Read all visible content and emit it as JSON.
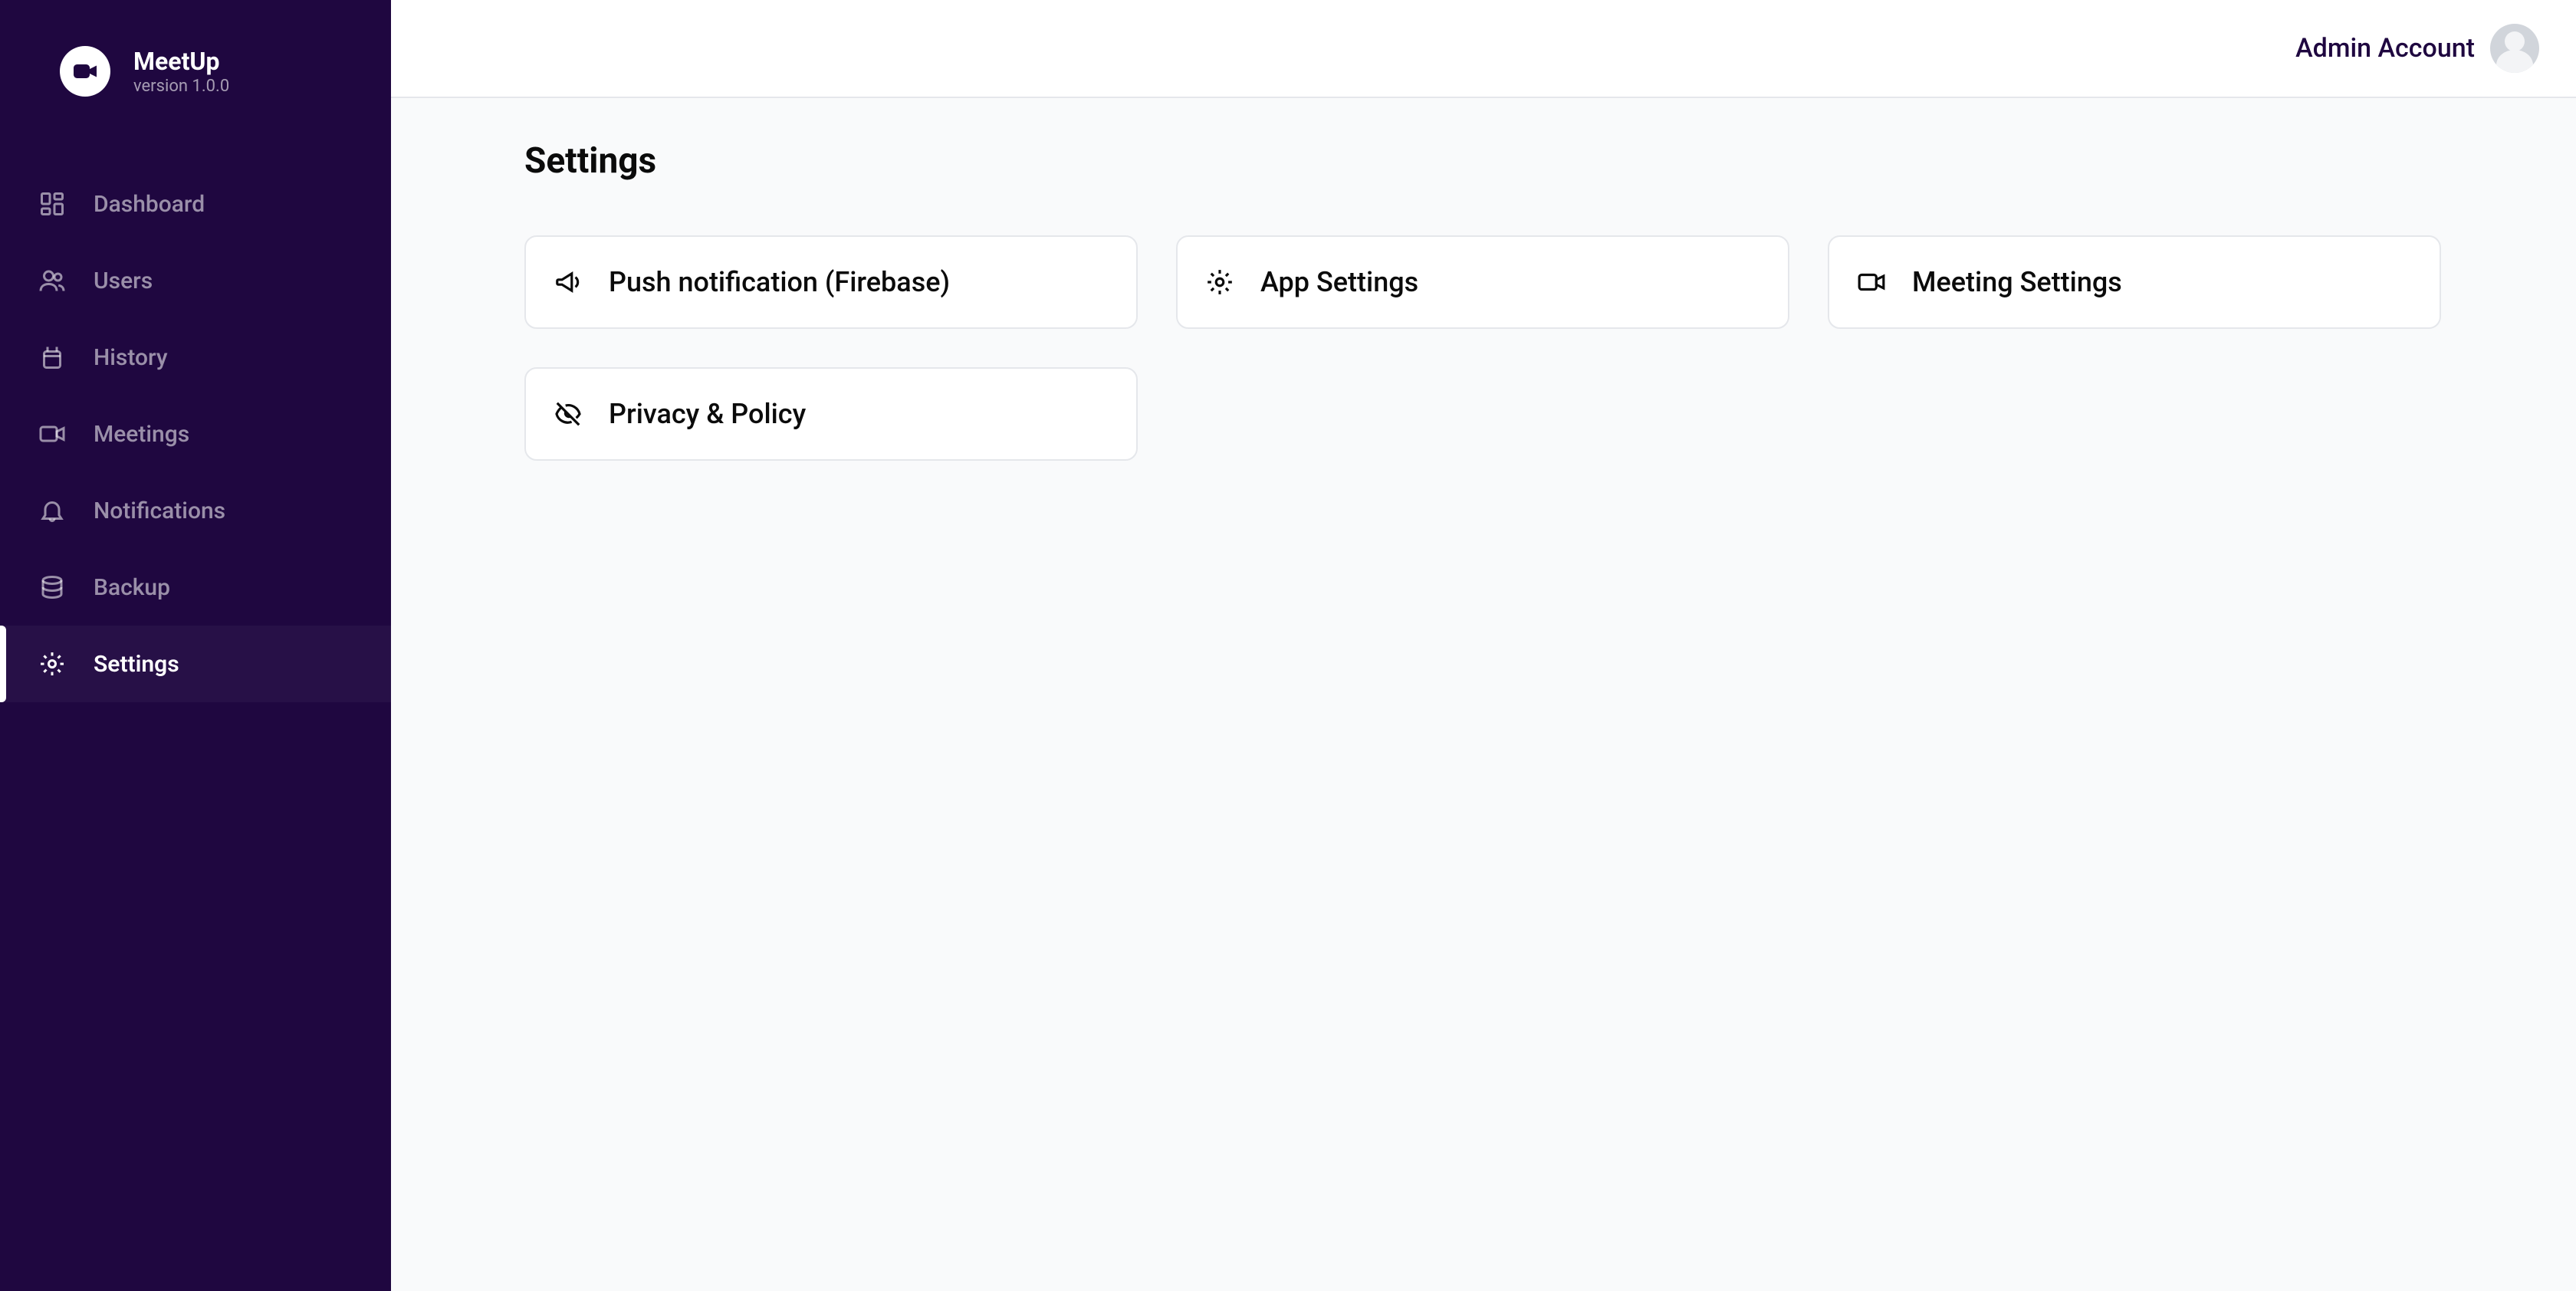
{
  "sidebar": {
    "app_name": "MeetUp",
    "version": "version 1.0.0",
    "items": [
      {
        "label": "Dashboard",
        "icon": "dashboard"
      },
      {
        "label": "Users",
        "icon": "users"
      },
      {
        "label": "History",
        "icon": "history"
      },
      {
        "label": "Meetings",
        "icon": "video"
      },
      {
        "label": "Notifications",
        "icon": "bell"
      },
      {
        "label": "Backup",
        "icon": "database"
      },
      {
        "label": "Settings",
        "icon": "gear",
        "active": true
      }
    ]
  },
  "topbar": {
    "account_name": "Admin Account"
  },
  "page": {
    "title": "Settings",
    "cards": [
      {
        "label": "Push notification (Firebase)",
        "icon": "megaphone"
      },
      {
        "label": "App Settings",
        "icon": "gear"
      },
      {
        "label": "Meeting Settings",
        "icon": "video"
      },
      {
        "label": "Privacy & Policy",
        "icon": "eye-off"
      }
    ]
  }
}
